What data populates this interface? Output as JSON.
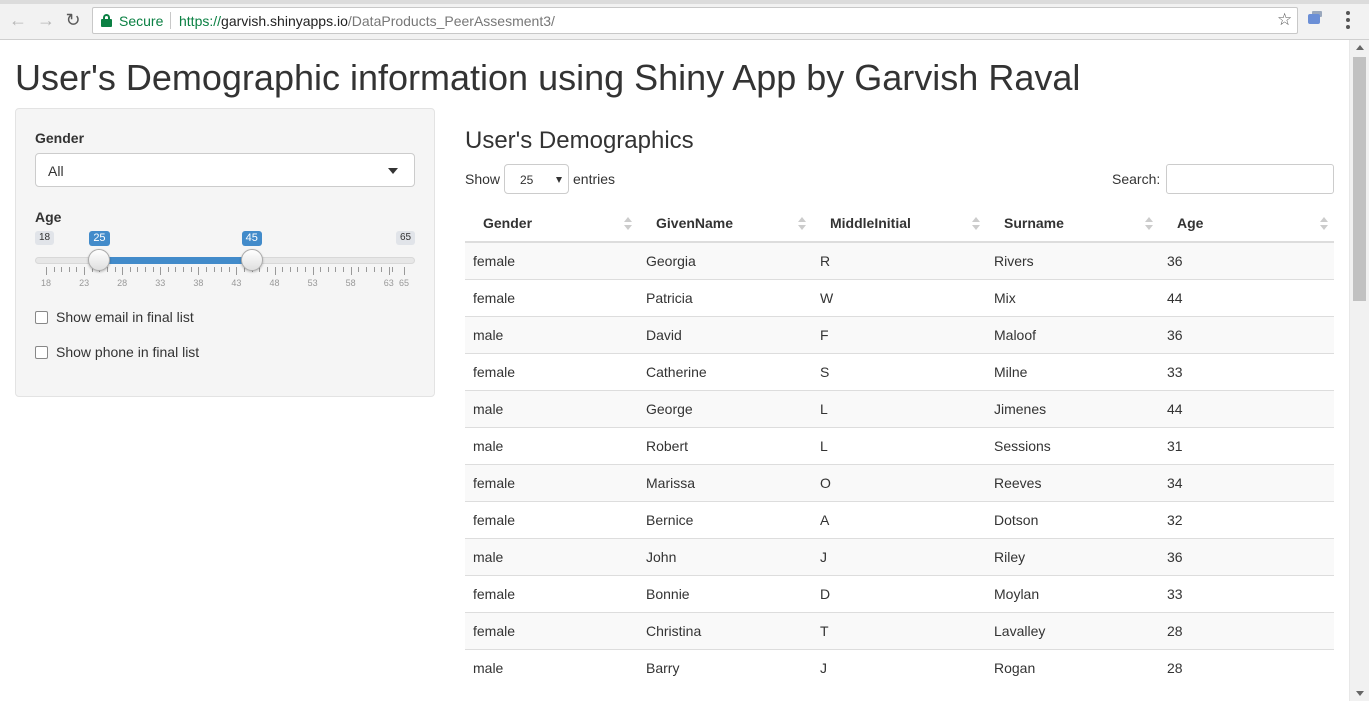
{
  "browser": {
    "secure_label": "Secure",
    "url_scheme": "https://",
    "url_host": "garvish.shinyapps.io",
    "url_path": "/DataProducts_PeerAssesment3/",
    "back_icon": "arrow-left-icon",
    "forward_icon": "arrow-right-icon",
    "reload_icon": "reload-icon",
    "star_icon": "star-icon",
    "secure_color": "#0b8043"
  },
  "page": {
    "title": "User's Demographic information using Shiny App by Garvish Raval"
  },
  "sidebar": {
    "gender_label": "Gender",
    "gender_value": "All",
    "age_label": "Age",
    "age_slider": {
      "min": 18,
      "max": 65,
      "from": 25,
      "to": 45,
      "min_label": "18",
      "max_label": "65",
      "from_label": "25",
      "to_label": "45",
      "tick_labels": [
        "18",
        "23",
        "28",
        "33",
        "38",
        "43",
        "48",
        "53",
        "58",
        "63",
        "65"
      ],
      "accent_color": "#428bca"
    },
    "checkbox_email": "Show email in final list",
    "checkbox_phone": "Show phone in final list"
  },
  "main": {
    "title": "User's Demographics",
    "show_label": "Show",
    "entries_value": "25",
    "entries_label": "entries",
    "search_label": "Search:",
    "columns": [
      "Gender",
      "GivenName",
      "MiddleInitial",
      "Surname",
      "Age"
    ],
    "rows": [
      [
        "female",
        "Georgia",
        "R",
        "Rivers",
        "36"
      ],
      [
        "female",
        "Patricia",
        "W",
        "Mix",
        "44"
      ],
      [
        "male",
        "David",
        "F",
        "Maloof",
        "36"
      ],
      [
        "female",
        "Catherine",
        "S",
        "Milne",
        "33"
      ],
      [
        "male",
        "George",
        "L",
        "Jimenes",
        "44"
      ],
      [
        "male",
        "Robert",
        "L",
        "Sessions",
        "31"
      ],
      [
        "female",
        "Marissa",
        "O",
        "Reeves",
        "34"
      ],
      [
        "female",
        "Bernice",
        "A",
        "Dotson",
        "32"
      ],
      [
        "male",
        "John",
        "J",
        "Riley",
        "36"
      ],
      [
        "female",
        "Bonnie",
        "D",
        "Moylan",
        "33"
      ],
      [
        "female",
        "Christina",
        "T",
        "Lavalley",
        "28"
      ],
      [
        "male",
        "Barry",
        "J",
        "Rogan",
        "28"
      ]
    ]
  }
}
